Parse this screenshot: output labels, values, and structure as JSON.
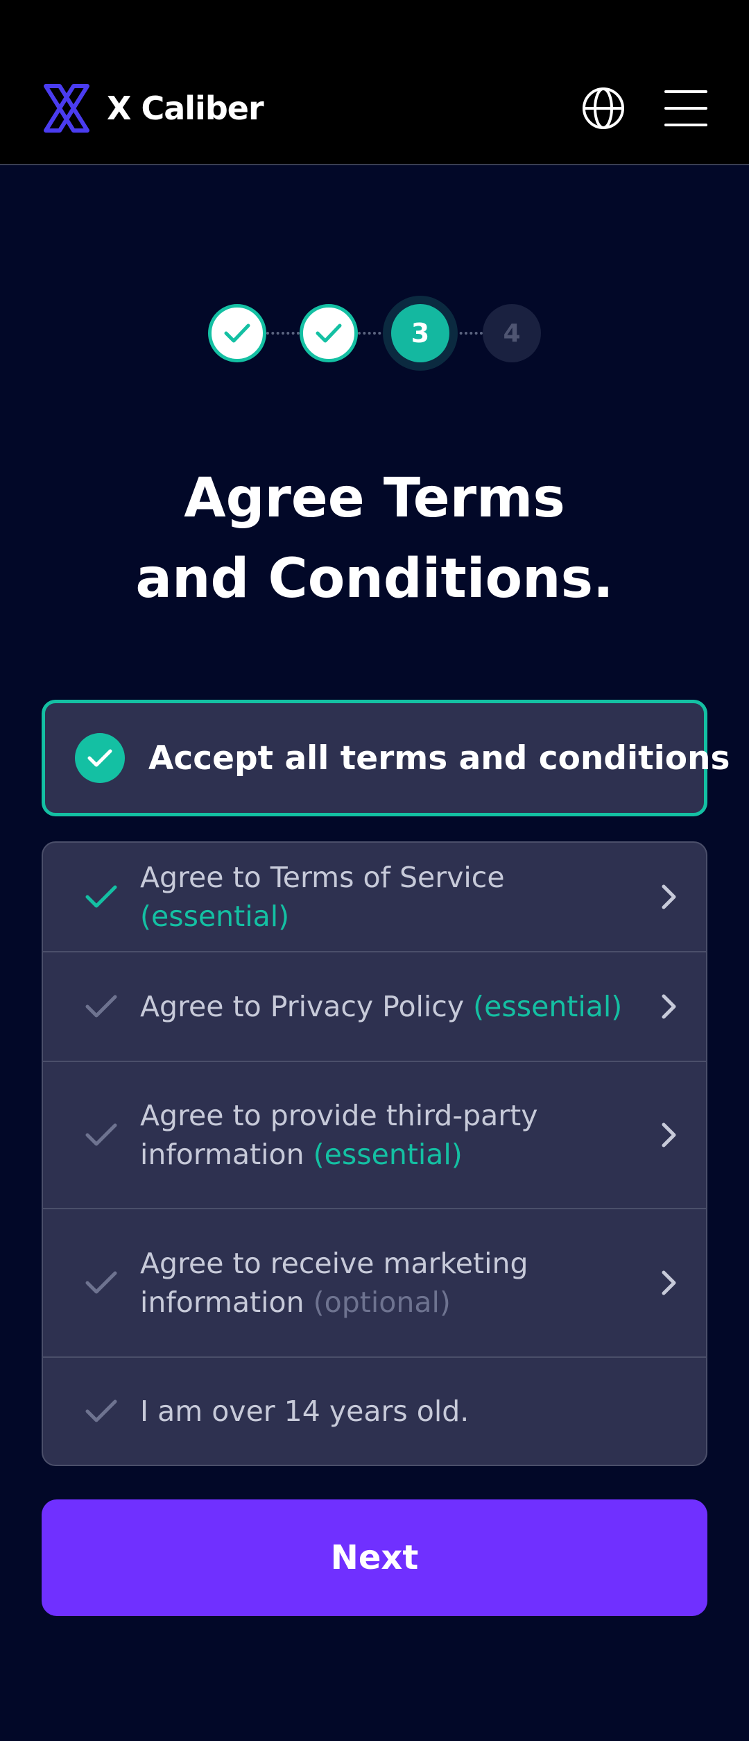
{
  "header": {
    "brand": "X Caliber",
    "logo_icon": "xcaliber-logo-icon",
    "language_icon": "globe-icon",
    "menu_icon": "hamburger-menu-icon"
  },
  "stepper": {
    "steps": [
      {
        "status": "done",
        "label": ""
      },
      {
        "status": "done",
        "label": ""
      },
      {
        "status": "active",
        "label": "3"
      },
      {
        "status": "pending",
        "label": "4"
      }
    ]
  },
  "page": {
    "title_line1": "Agree Terms",
    "title_line2": "and Conditions."
  },
  "accept_all": {
    "label": "Accept all terms and conditions",
    "checked": true
  },
  "terms": [
    {
      "label": "Agree to Terms of Service ",
      "tag": "(essential)",
      "tag_type": "essential",
      "checked": true,
      "has_chevron": true
    },
    {
      "label": "Agree to Privacy Policy ",
      "tag": "(essential)",
      "tag_type": "essential",
      "checked": false,
      "has_chevron": true
    },
    {
      "label_line1": "Agree to provide third-party",
      "label_line2": "information ",
      "tag": "(essential)",
      "tag_type": "essential",
      "checked": false,
      "has_chevron": true
    },
    {
      "label_line1": "Agree to receive marketing",
      "label_line2": "information ",
      "tag": "(optional)",
      "tag_type": "optional",
      "checked": false,
      "has_chevron": true
    },
    {
      "label": "I am over 14 years old.",
      "checked": false,
      "has_chevron": false
    }
  ],
  "colors": {
    "background": "#020828",
    "accent_teal": "#14c0a3",
    "button_purple": "#7030ff",
    "card": "#2e3150"
  },
  "next_button": {
    "label": "Next"
  }
}
